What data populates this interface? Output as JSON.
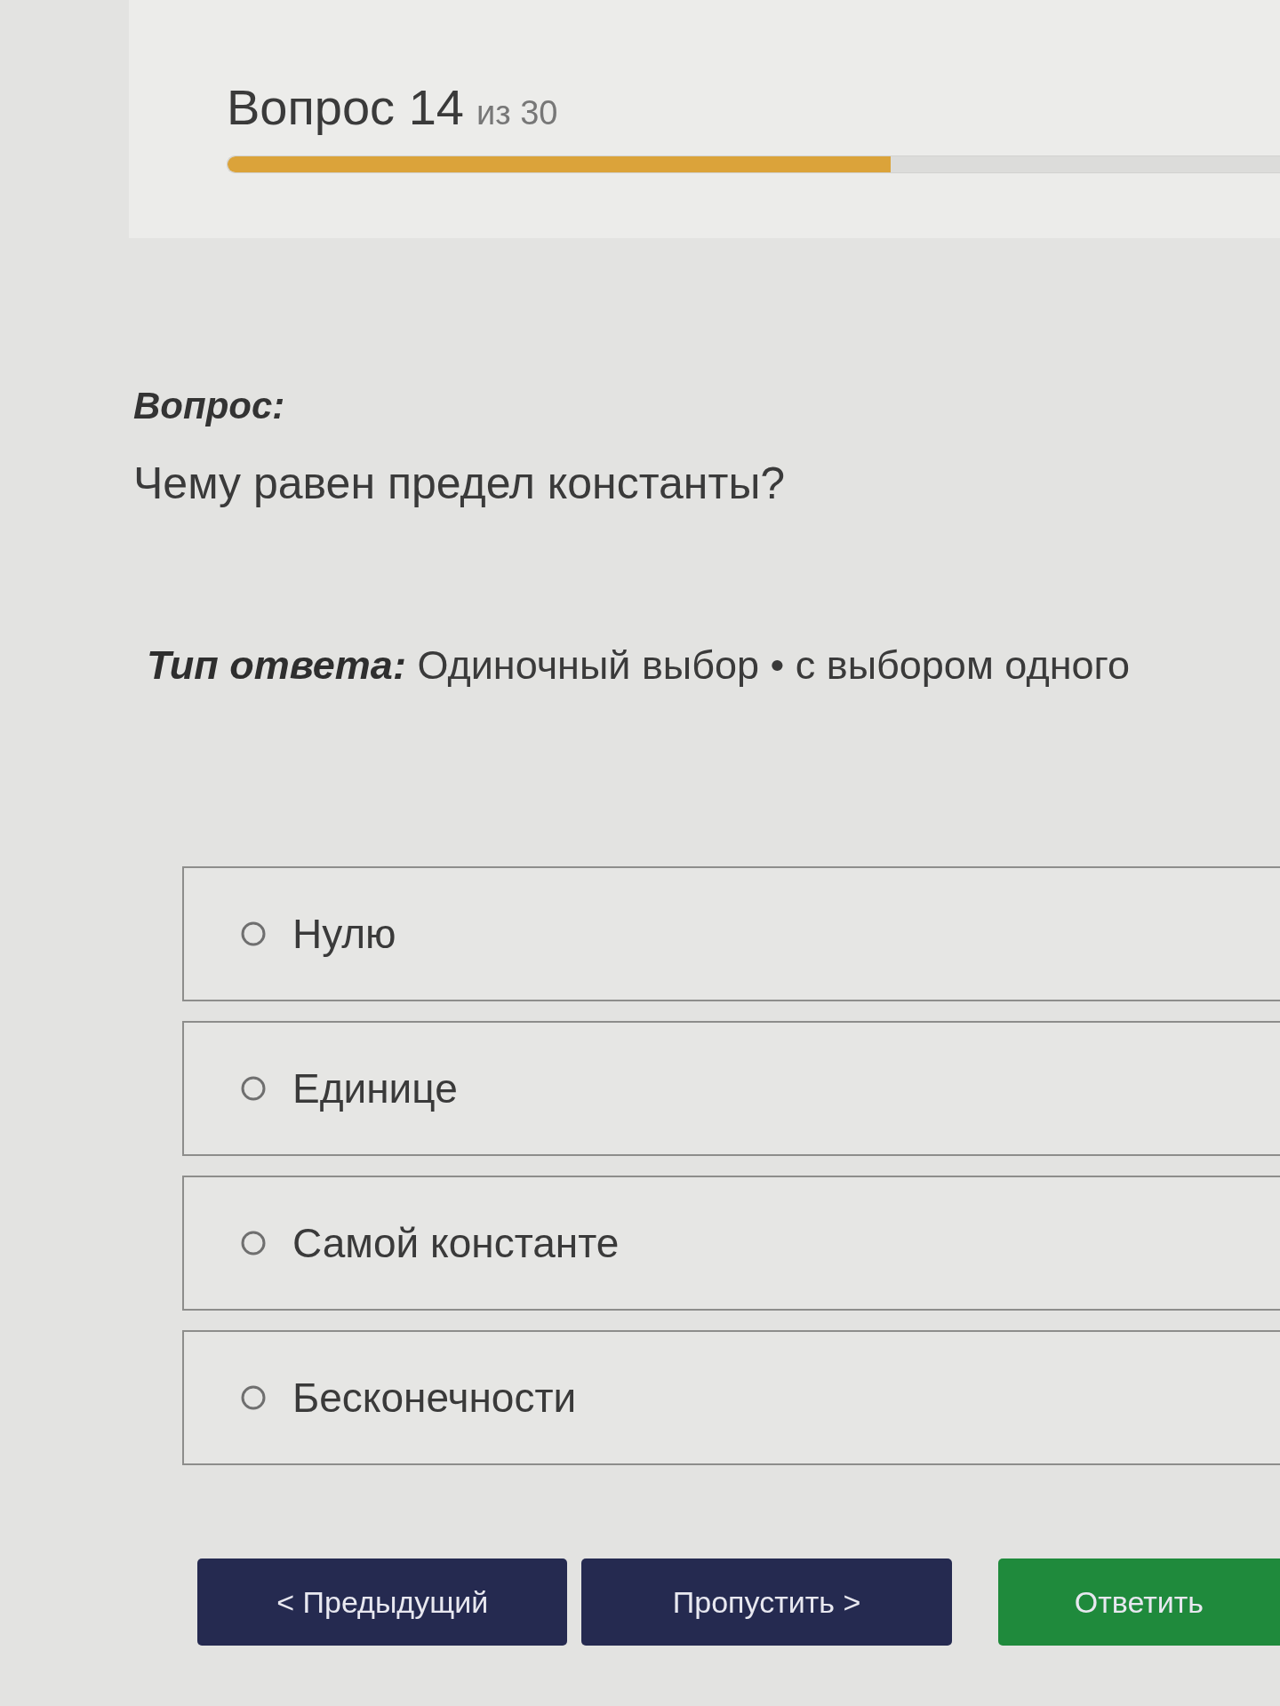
{
  "header": {
    "title": "Вопрос 14",
    "counter": "из 30",
    "progress": {
      "level": 0.63
    }
  },
  "question": {
    "label": "Вопрос:",
    "text": "Чему равен предел константы?"
  },
  "answer_type": "**Тип ответа:** Одиночный выбор • с выбором одного",
  "options": [
    {
      "label": "Нулю",
      "selected": false
    },
    {
      "label": "Единице",
      "selected": false
    },
    {
      "label": "Самой константе",
      "selected": false
    },
    {
      "label": "Бесконечности",
      "selected": false
    }
  ],
  "buttons": [
    {
      "label": "< Предыдущий",
      "kind": "secondary"
    },
    {
      "label": "Пропустить >",
      "kind": "secondary"
    },
    {
      "label": "Ответить",
      "kind": "primary"
    }
  ]
}
